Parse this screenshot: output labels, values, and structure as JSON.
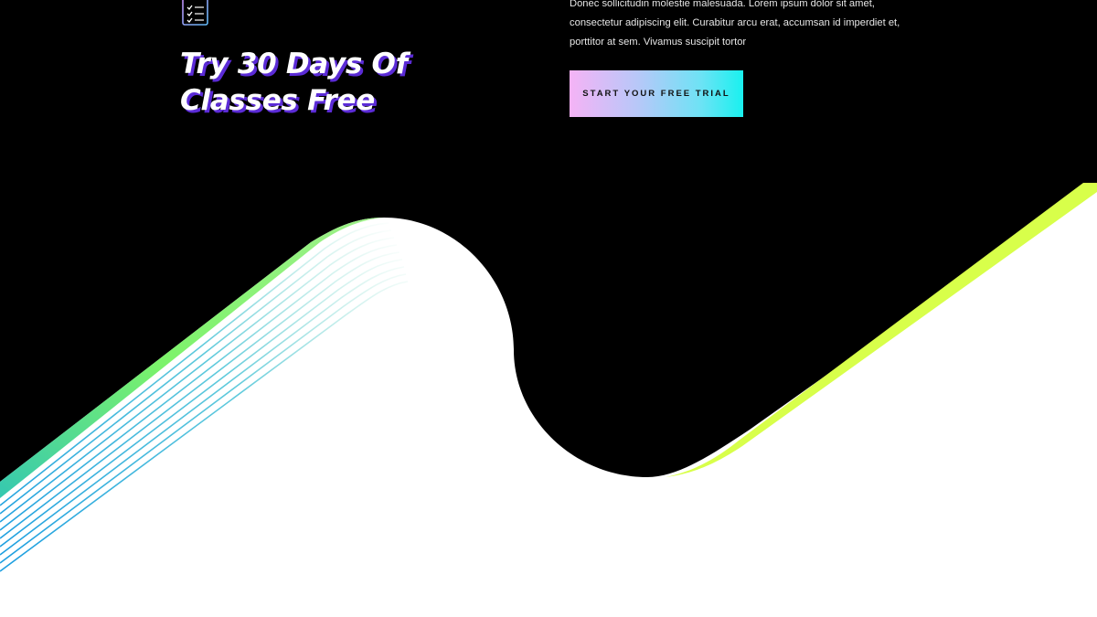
{
  "hero": {
    "icon": "checklist-icon",
    "headline": "Try 30 Days Of Classes Free",
    "description": "Donec sollicitudin molestie malesuada. Lorem ipsum dolor sit amet, consectetur adipiscing elit. Curabitur arcu erat, accumsan id imperdiet et, porttitor at sem. Vivamus suscipit tortor",
    "cta_label": "START YOUR FREE TRIAL"
  },
  "colors": {
    "background_dark": "#000000",
    "background_light": "#ffffff",
    "headline_shadow": "#5b2bd6",
    "accent_lime": "#d8ff4a",
    "accent_green": "#7cf36a",
    "accent_blue": "#1e9fe0",
    "button_gradient_start": "#f5b3f6",
    "button_gradient_end": "#19f1ef"
  }
}
